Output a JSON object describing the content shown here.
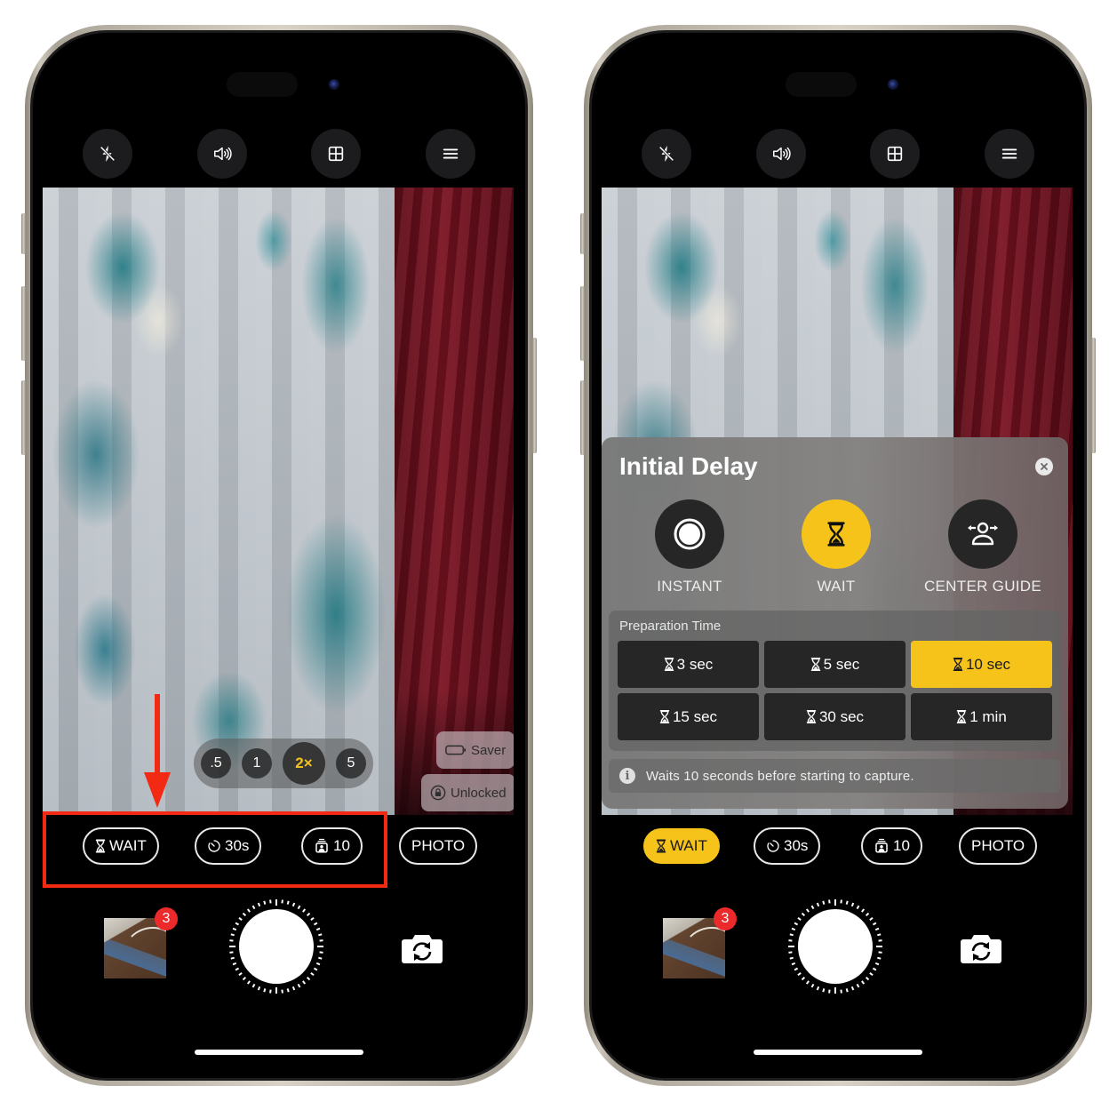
{
  "colors": {
    "accent_yellow": "#f6c31b",
    "highlight_red": "#f22a14",
    "badge_red": "#ec2a2c",
    "button_dark": "#262626"
  },
  "phones": [
    {
      "top_controls": [
        {
          "icon": "flash-off-icon"
        },
        {
          "icon": "speaker-sound-icon"
        },
        {
          "icon": "grid-icon"
        },
        {
          "icon": "menu-icon"
        }
      ],
      "zoom_levels": [
        ".5",
        "1",
        "2×",
        "5"
      ],
      "zoom_selected": "2×",
      "chips": [
        {
          "icon": "battery-icon",
          "label": "Saver"
        },
        {
          "icon": "lock-icon",
          "label": "Unlocked"
        }
      ],
      "mode_buttons": [
        {
          "icon": "hourglass-icon",
          "label": "WAIT",
          "active": false
        },
        {
          "icon": "timer-icon",
          "label": "30s",
          "active": false
        },
        {
          "icon": "burst-photo-icon",
          "label": "10",
          "active": false
        },
        {
          "icon": "",
          "label": "PHOTO",
          "active": false
        }
      ],
      "gallery_badge": "3",
      "annotations": {
        "arrow": "red-down-arrow",
        "highlight": "red-box-around-wait-30s-10"
      }
    },
    {
      "top_controls": [
        {
          "icon": "flash-off-icon"
        },
        {
          "icon": "speaker-sound-icon"
        },
        {
          "icon": "grid-icon"
        },
        {
          "icon": "menu-icon"
        }
      ],
      "panel": {
        "title": "Initial Delay",
        "options": [
          {
            "icon": "instant-record-icon",
            "label": "INSTANT",
            "active": false
          },
          {
            "icon": "hourglass-icon",
            "label": "WAIT",
            "active": true
          },
          {
            "icon": "center-guide-person-icon",
            "label": "CENTER GUIDE",
            "active": false
          }
        ],
        "prep_title": "Preparation Time",
        "prep_options": [
          {
            "label": "3 sec",
            "active": false
          },
          {
            "label": "5 sec",
            "active": false
          },
          {
            "label": "10 sec",
            "active": true
          },
          {
            "label": "15 sec",
            "active": false
          },
          {
            "label": "30 sec",
            "active": false
          },
          {
            "label": "1 min",
            "active": false
          }
        ],
        "info": "Waits 10 seconds before starting to capture."
      },
      "mode_buttons": [
        {
          "icon": "hourglass-icon",
          "label": "WAIT",
          "active": true
        },
        {
          "icon": "timer-icon",
          "label": "30s",
          "active": false
        },
        {
          "icon": "burst-photo-icon",
          "label": "10",
          "active": false
        },
        {
          "icon": "",
          "label": "PHOTO",
          "active": false
        }
      ],
      "gallery_badge": "3"
    }
  ]
}
